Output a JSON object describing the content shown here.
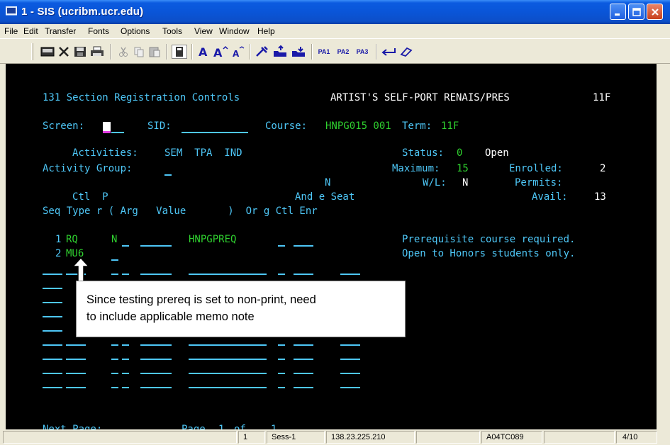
{
  "window": {
    "title": "1 - SIS (ucribm.ucr.edu)"
  },
  "menu": [
    "File",
    "Edit",
    "Transfer",
    "Fonts",
    "Options",
    "Tools",
    "View",
    "Window",
    "Help"
  ],
  "toolbar": {
    "pa1": "PA1",
    "pa2": "PA2",
    "pa3": "PA3"
  },
  "screen": {
    "title": "131 Section Registration Controls",
    "course_title": "ARTIST'S SELF-PORT RENAIS/PRES",
    "term_code": "11F",
    "screen_label": "Screen:",
    "sid_label": "SID:",
    "course_label": "Course:",
    "course_value": "HNPG015 001",
    "term_label": "Term:",
    "term_value": "11F",
    "activities_label": "Activities:",
    "activities_value": "SEM  TPA  IND",
    "status_label": "Status:",
    "status_code": "0",
    "status_text": "Open",
    "activity_group_label": "Activity Group:",
    "maximum_label": "Maximum:",
    "maximum_value": "15",
    "enrolled_label": "Enrolled:",
    "enrolled_value": "2",
    "wl_label": "W/L:",
    "wl_value": "N",
    "permits_label": "Permits:",
    "avail_label": "Avail:",
    "avail_value": "13",
    "header_n": "N",
    "header_line1": "Ctl  P",
    "header_and_seat": "And e Seat",
    "header_line2": "Seq Type r ( Arg   Value       )  Or g Ctl Enr",
    "rows": [
      {
        "seq": "1",
        "type": "RQ",
        "p": "N",
        "value": "HNPGPREQ",
        "message": "Prerequisite course required."
      },
      {
        "seq": "2",
        "type": "MU6",
        "p": "",
        "value": "",
        "message": "Open to Honors students only."
      }
    ],
    "next_page_label": "Next Page:",
    "page_label": "Page",
    "page_current": "1",
    "page_of": "of",
    "page_total": "1"
  },
  "callout": {
    "line1": "Since testing prereq is set to non-print, need",
    "line2": "to include applicable memo note"
  },
  "statusbar": {
    "session_num": "1",
    "session_name": "Sess-1",
    "ip": "138.23.225.210",
    "lu": "A04TC089",
    "cursor_pos": "4/10"
  }
}
